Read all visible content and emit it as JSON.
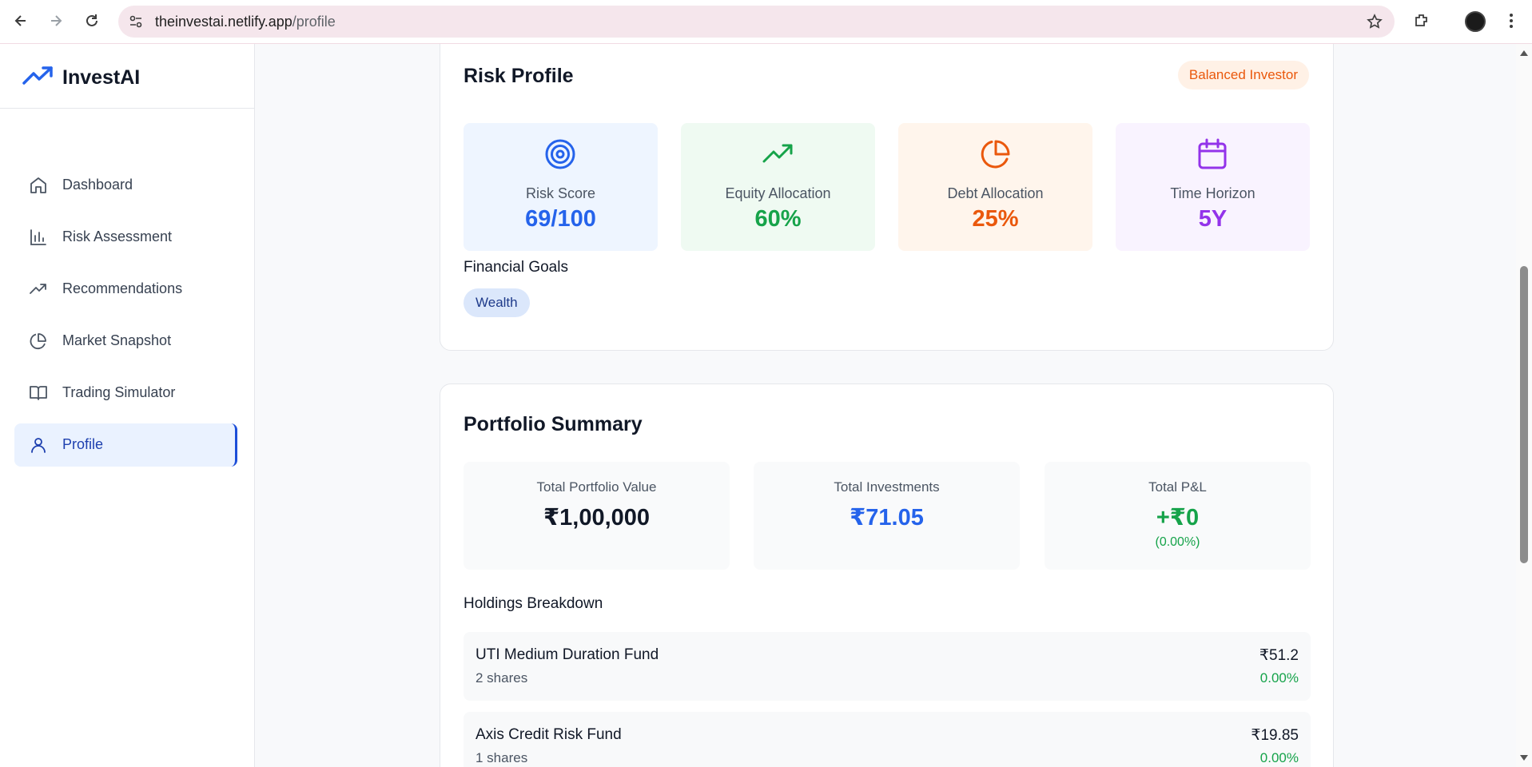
{
  "browser": {
    "url_host": "theinvestai.netlify.app",
    "url_path": "/profile"
  },
  "sidebar": {
    "brand": "InvestAI",
    "items": [
      {
        "label": "Dashboard",
        "icon": "home-icon"
      },
      {
        "label": "Risk Assessment",
        "icon": "bar-chart-icon"
      },
      {
        "label": "Recommendations",
        "icon": "trending-up-icon"
      },
      {
        "label": "Market Snapshot",
        "icon": "pie-chart-icon"
      },
      {
        "label": "Trading Simulator",
        "icon": "book-open-icon"
      },
      {
        "label": "Profile",
        "icon": "user-icon",
        "active": true
      }
    ]
  },
  "risk_profile": {
    "title": "Risk Profile",
    "badge": "Balanced Investor",
    "metrics": [
      {
        "label": "Risk Score",
        "value": "69/100",
        "icon": "target-icon",
        "color": "#2563eb"
      },
      {
        "label": "Equity Allocation",
        "value": "60%",
        "icon": "trending-up-icon",
        "color": "#16a34a"
      },
      {
        "label": "Debt Allocation",
        "value": "25%",
        "icon": "pie-chart-icon",
        "color": "#ea580c"
      },
      {
        "label": "Time Horizon",
        "value": "5Y",
        "icon": "calendar-icon",
        "color": "#9333ea"
      }
    ],
    "goals_title": "Financial Goals",
    "goals": [
      "Wealth"
    ]
  },
  "portfolio": {
    "title": "Portfolio Summary",
    "summary": [
      {
        "label": "Total Portfolio Value",
        "value": "₹1,00,000",
        "color": "#111827"
      },
      {
        "label": "Total Investments",
        "value": "₹71.05",
        "color": "#2563eb"
      },
      {
        "label": "Total P&L",
        "value": "+₹0",
        "sub": "(0.00%)",
        "color": "#16a34a"
      }
    ],
    "holdings_title": "Holdings Breakdown",
    "holdings": [
      {
        "name": "UTI Medium Duration Fund",
        "shares": "2 shares",
        "value": "₹51.2",
        "change": "0.00%"
      },
      {
        "name": "Axis Credit Risk Fund",
        "shares": "1 shares",
        "value": "₹19.85",
        "change": "0.00%"
      }
    ]
  }
}
